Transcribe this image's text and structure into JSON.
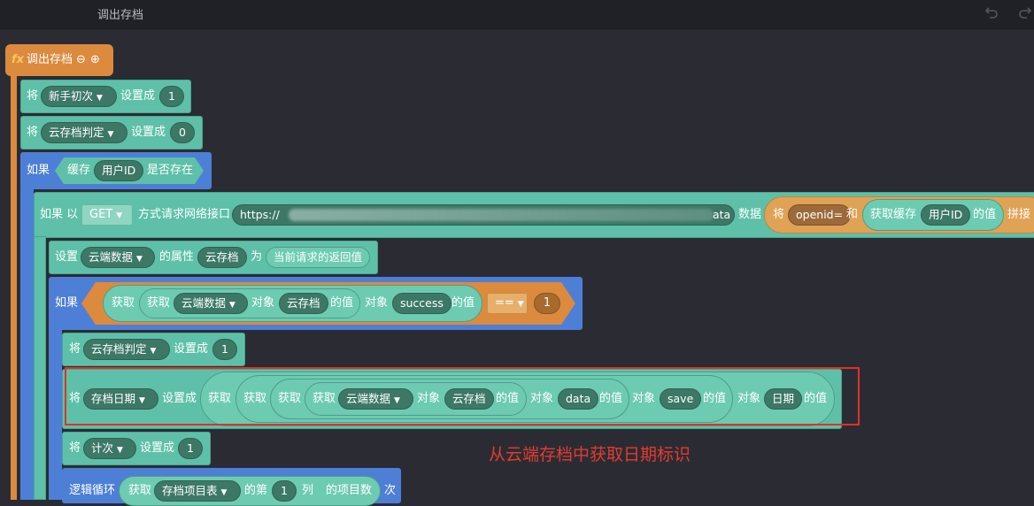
{
  "header": {
    "title": "调出存档",
    "undo_icon": "undo-icon",
    "redo_icon": "redo-icon"
  },
  "func": {
    "fx": "fx",
    "name": "调出存档",
    "minus": "⊖",
    "plus": "⊕"
  },
  "b1": {
    "jiang": "将",
    "var": "新手初次",
    "set": "设置成",
    "val": "1"
  },
  "b2": {
    "jiang": "将",
    "var": "云存档判定",
    "set": "设置成",
    "val": "0"
  },
  "b3": {
    "if": "如果",
    "cache": "缓存",
    "key": "用户ID",
    "exists": "是否存在"
  },
  "b4": {
    "if_with": "如果 以",
    "method": "GET",
    "req": "方式请求网络接口",
    "url_prefix": "https://",
    "url_suffix": "ata",
    "data": "数据",
    "jiang": "将",
    "openid": "openid=",
    "he": "和",
    "get_cache": "获取缓存",
    "uid": "用户ID",
    "value": "的值",
    "concat": "拼接"
  },
  "b5": {
    "set": "设置",
    "obj": "云端数据",
    "attr": "的属性",
    "prop": "云存档",
    "as": "为",
    "ret": "当前请求的返回值"
  },
  "b6": {
    "if": "如果",
    "get": "获取",
    "get2": "获取",
    "obj": "云端数据",
    "duixiang": "对象",
    "prop": "云存档",
    "value": "的值",
    "duixiang2": "对象",
    "success": "success",
    "value2": "的值",
    "op": "==",
    "num": "1"
  },
  "b7": {
    "jiang": "将",
    "var": "云存档判定",
    "set": "设置成",
    "val": "1"
  },
  "b8": {
    "jiang": "将",
    "var": "存档日期",
    "set": "设置成",
    "get1": "获取",
    "get2": "获取",
    "get3": "获取",
    "get4": "获取",
    "obj": "云端数据",
    "d1": "对象",
    "prop": "云存档",
    "v1": "的值",
    "d2": "对象",
    "data": "data",
    "v2": "的值",
    "d3": "对象",
    "save": "save",
    "v3": "的值",
    "d4": "对象",
    "date": "日期",
    "v4": "的值"
  },
  "b9": {
    "jiang": "将",
    "var": "计次",
    "set": "设置成",
    "val": "1"
  },
  "b10": {
    "loop": "逻辑循环",
    "get": "获取",
    "table": "存档项目表",
    "di": "的第",
    "num": "1",
    "col": "列",
    "count": "的项目数",
    "ci": "次"
  },
  "annotation": "从云端存档中获取日期标识",
  "colors": {
    "teal": "#5ec0a8",
    "blue": "#4e7fd6",
    "orange": "#dc8a3e",
    "highlight": "#e0302c"
  }
}
